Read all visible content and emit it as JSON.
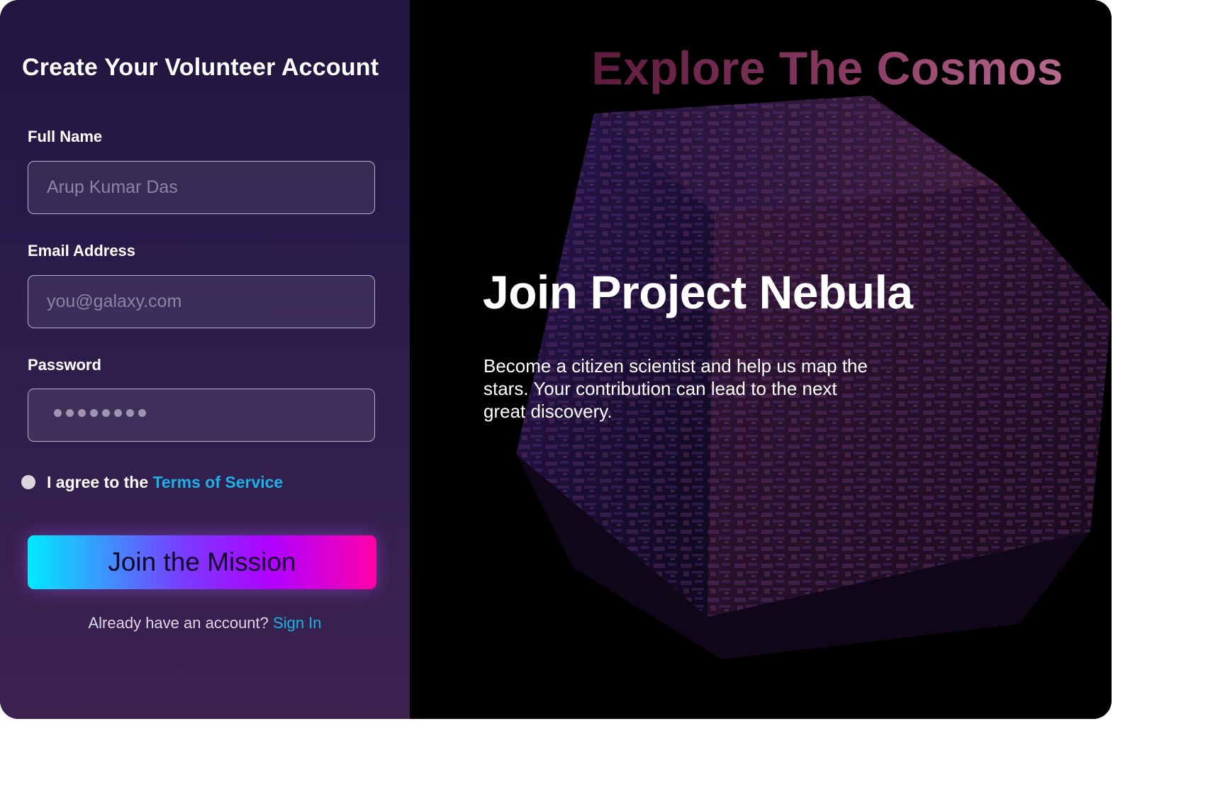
{
  "form": {
    "title": "Create Your Volunteer Account",
    "full_name": {
      "label": "Full Name",
      "placeholder": "Arup Kumar Das",
      "value": ""
    },
    "email": {
      "label": "Email Address",
      "placeholder": "you@galaxy.com",
      "value": ""
    },
    "password": {
      "label": "Password",
      "masked_length": 8
    },
    "terms": {
      "prefix": "I agree to the",
      "link": "Terms of Service",
      "checked": false
    },
    "submit_label": "Join the Mission",
    "signin": {
      "prefix": "Already have an account?",
      "link": "Sign In"
    }
  },
  "hero": {
    "brand": "Explore The Cosmos",
    "title": "Join Project Nebula",
    "description": "Become a citizen scientist and help us map the stars. Your contribution can lead to the next great discovery."
  },
  "colors": {
    "panel_top": "#211640",
    "panel_bottom": "#3d2250",
    "link": "#1bb3e6",
    "button_gradient": [
      "#00eaff",
      "#b000ff",
      "#ff00a8"
    ],
    "brand_gradient": [
      "#5e1b3c",
      "#b86a8d"
    ],
    "cube_tint": "#6a3a8c"
  }
}
